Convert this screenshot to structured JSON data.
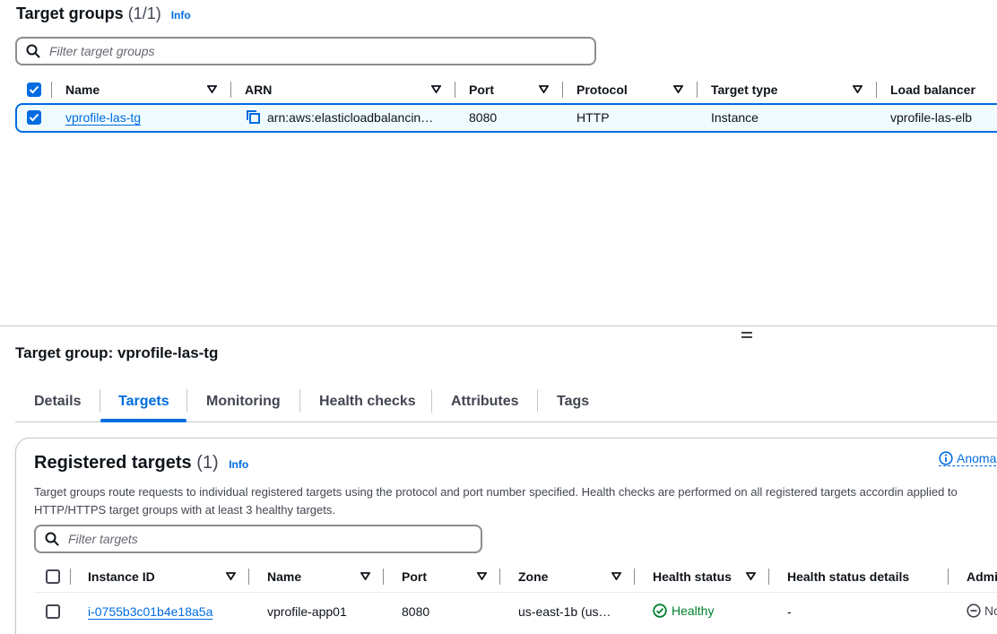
{
  "target_groups": {
    "title": "Target groups",
    "count": "(1/1)",
    "info": "Info",
    "search_placeholder": "Filter target groups",
    "columns": [
      "Name",
      "ARN",
      "Port",
      "Protocol",
      "Target type",
      "Load balancer"
    ],
    "row": {
      "name": "vprofile-las-tg",
      "arn": "arn:aws:elasticloadbalancin…",
      "port": "8080",
      "protocol": "HTTP",
      "target_type": "Instance",
      "load_balancer": "vprofile-las-elb"
    }
  },
  "detail": {
    "title": "Target group: vprofile-las-tg",
    "tabs": [
      "Details",
      "Targets",
      "Monitoring",
      "Health checks",
      "Attributes",
      "Tags"
    ],
    "active_tab": "Targets"
  },
  "registered_targets": {
    "title": "Registered targets",
    "count": "(1)",
    "info": "Info",
    "anomaly_link": "Anoma",
    "description": "Target groups route requests to individual registered targets using the protocol and port number specified. Health checks are performed on all registered targets accordin applied to HTTP/HTTPS target groups with at least 3 healthy targets.",
    "search_placeholder": "Filter targets",
    "columns": [
      "Instance ID",
      "Name",
      "Port",
      "Zone",
      "Health status",
      "Health status details",
      "Admi"
    ],
    "row": {
      "instance_id": "i-0755b3c01b4e18a5a",
      "name": "vprofile-app01",
      "port": "8080",
      "zone": "us-east-1b (us…",
      "health_status": "Healthy",
      "health_details": "-",
      "admin": "No"
    }
  },
  "colors": {
    "accent": "#006ce0",
    "healthy": "#00802f",
    "border": "#8c8c94"
  }
}
